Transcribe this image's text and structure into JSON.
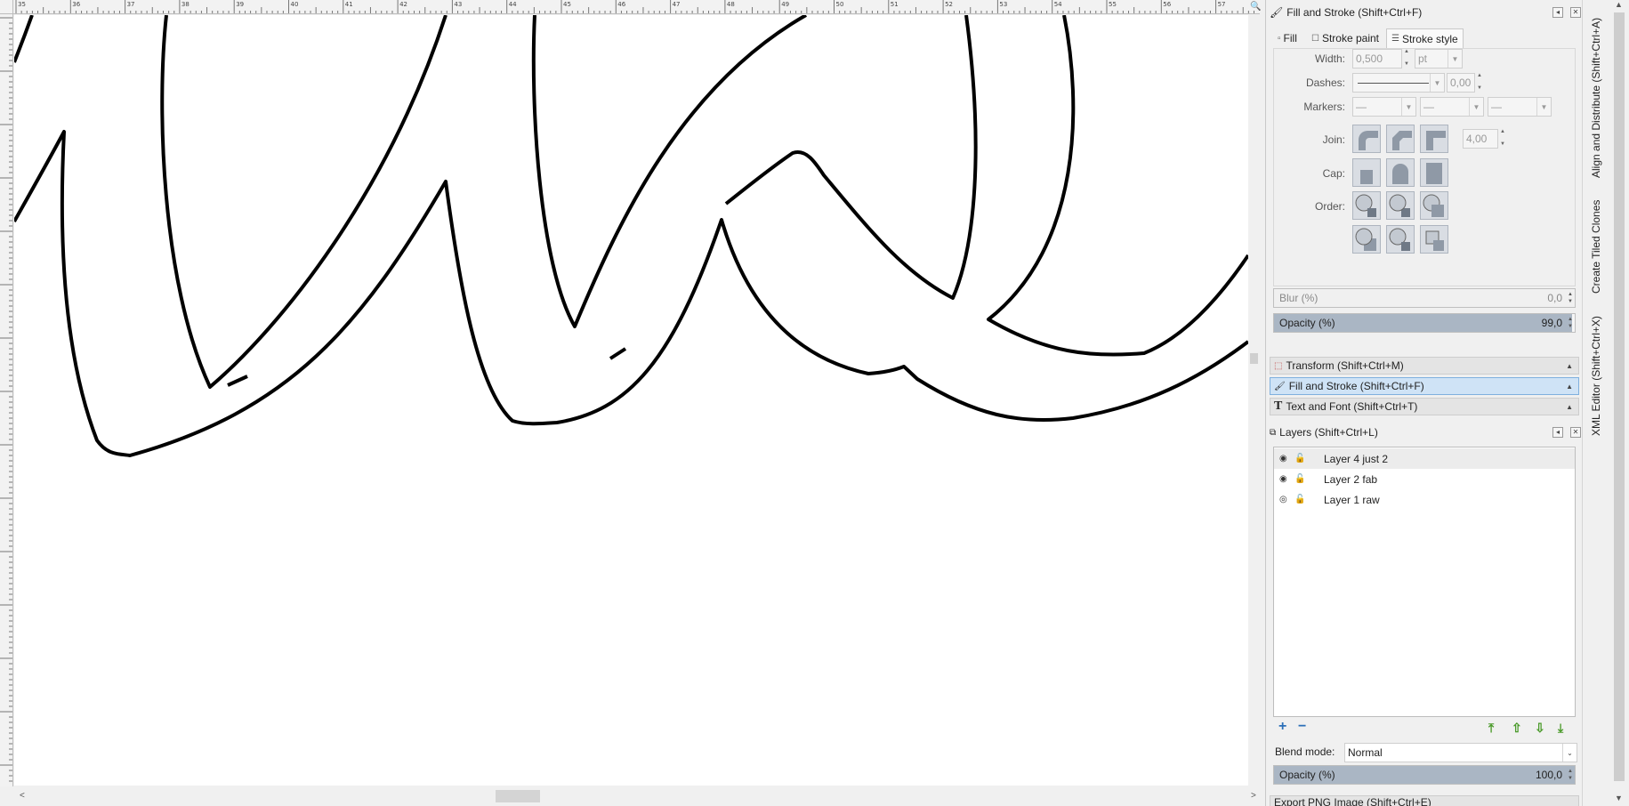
{
  "ruler": {
    "top_labels": [
      "35",
      "36",
      "37",
      "38",
      "39",
      "40",
      "41",
      "42",
      "43",
      "44",
      "45",
      "46",
      "47",
      "48",
      "49",
      "50",
      "51",
      "52",
      "53",
      "54",
      "55",
      "56",
      "57"
    ],
    "left_labels": [
      "2",
      "0",
      "6",
      "2",
      "0",
      "4",
      "2",
      "0",
      "3",
      "2",
      "0",
      "2",
      "1",
      "0",
      "9",
      "1",
      "8",
      "1",
      "7",
      "1",
      "6",
      "1",
      "5",
      "1",
      "4",
      "1",
      "3"
    ]
  },
  "fill_stroke": {
    "title": "Fill and Stroke (Shift+Ctrl+F)",
    "tabs": [
      "Fill",
      "Stroke paint",
      "Stroke style"
    ],
    "width_label": "Width:",
    "width_value": "0,500",
    "width_unit": "pt",
    "dashes_label": "Dashes:",
    "dash_offset": "0,00",
    "markers_label": "Markers:",
    "marker_start": "—",
    "marker_mid": "—",
    "marker_end": "—",
    "join_label": "Join:",
    "miter_limit": "4,00",
    "cap_label": "Cap:",
    "order_label": "Order:",
    "blur_label": "Blur (%)",
    "blur_value": "0,0",
    "opacity_label": "Opacity (%)",
    "opacity_value": "99,0"
  },
  "collapsed": {
    "transform": "Transform (Shift+Ctrl+M)",
    "fill_stroke": "Fill and Stroke (Shift+Ctrl+F)",
    "text_font": "Text and Font (Shift+Ctrl+T)"
  },
  "layers": {
    "title": "Layers (Shift+Ctrl+L)",
    "items": [
      {
        "name": "Layer 4 just 2"
      },
      {
        "name": "Layer 2 fab"
      },
      {
        "name": "Layer 1 raw"
      }
    ],
    "blend_label": "Blend mode:",
    "blend_value": "Normal",
    "opacity_label": "Opacity (%)",
    "opacity_value": "100,0",
    "export_header": "Export PNG Image (Shift+Ctrl+E)"
  },
  "vertical_tabs": {
    "align": "Align and Distribute (Shift+Ctrl+A)",
    "tiled": "Create Tiled Clones",
    "xml": "XML Editor (Shift+Ctrl+X)"
  },
  "colors": {
    "selected_header": "#cfe3f6",
    "slider_fill": "#aab6c4",
    "lock_green": "#3a7a1e"
  }
}
